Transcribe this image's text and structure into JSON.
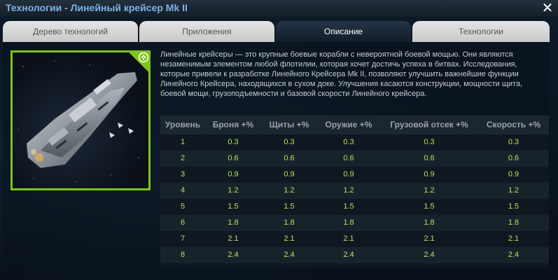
{
  "window": {
    "title": "Технологии - Линейный крейсер Mk II",
    "close_glyph": "✕"
  },
  "tabs": [
    {
      "label": "Дерево технологий",
      "active": false
    },
    {
      "label": "Приложения",
      "active": false
    },
    {
      "label": "Описание",
      "active": true
    },
    {
      "label": "Технологии",
      "active": false
    }
  ],
  "image": {
    "subject": "battlecruiser-ship",
    "badge_icon": "upgrade-emblem-icon",
    "accent_color": "#7fc31c"
  },
  "description": "Линейные крейсеры — это крупные боевые корабли с невероятной боевой мощью. Они являются незаменимым элементом любой флотилии, которая хочет достичь успеха в битвах. Исследования, которые привели к разработке Линейного Крейсера Mk II, позволяют улучшить важнейшие функции Линейного Крейсера, находящихся в сухом доке. Улучшения касаются конструкции, мощности щита, боевой мощи, грузоподъемности и базовой скорости Линейного крейсера.",
  "table": {
    "headers": [
      "Уровень",
      "Броня +%",
      "Щиты +%",
      "Оружие +%",
      "Грузовой отсек +%",
      "Скорость +%"
    ],
    "rows": [
      [
        "1",
        "0.3",
        "0.3",
        "0.3",
        "0.3",
        "0.3"
      ],
      [
        "2",
        "0.6",
        "0.6",
        "0.6",
        "0.6",
        "0.6"
      ],
      [
        "3",
        "0.9",
        "0.9",
        "0.9",
        "0.9",
        "0.9"
      ],
      [
        "4",
        "1.2",
        "1.2",
        "1.2",
        "1.2",
        "1.2"
      ],
      [
        "5",
        "1.5",
        "1.5",
        "1.5",
        "1.5",
        "1.5"
      ],
      [
        "6",
        "1.8",
        "1.8",
        "1.8",
        "1.8",
        "1.8"
      ],
      [
        "7",
        "2.1",
        "2.1",
        "2.1",
        "2.1",
        "2.1"
      ],
      [
        "8",
        "2.4",
        "2.4",
        "2.4",
        "2.4",
        "2.4"
      ]
    ],
    "value_color": "#b6e05a",
    "header_color": "#9ba3ab"
  }
}
